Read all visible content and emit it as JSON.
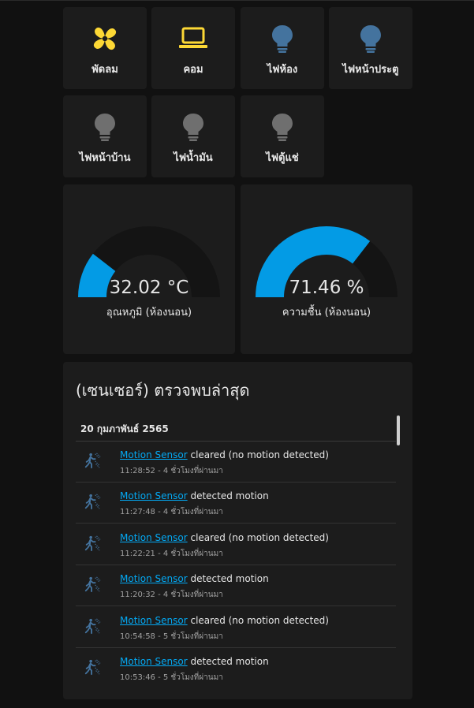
{
  "buttons": [
    {
      "label": "พัดลม",
      "icon": "fan-icon",
      "color": "#fdd835"
    },
    {
      "label": "คอม",
      "icon": "laptop-icon",
      "color": "#fdd835"
    },
    {
      "label": "ไฟห้อง",
      "icon": "lightbulb-icon",
      "color": "#44739e"
    },
    {
      "label": "ไฟหน้าประตู",
      "icon": "lightbulb-icon",
      "color": "#44739e"
    },
    {
      "label": "ไฟหน้าบ้าน",
      "icon": "lightbulb-icon",
      "color": "#6f6f6f"
    },
    {
      "label": "ไฟน้ำมัน",
      "icon": "lightbulb-icon",
      "color": "#6f6f6f"
    },
    {
      "label": "ไฟตู้แช่",
      "icon": "lightbulb-icon",
      "color": "#6f6f6f"
    }
  ],
  "gauges": [
    {
      "value": "32.02 °C",
      "name": "อุณหภูมิ (ห้องนอน)",
      "fraction": 0.21,
      "color": "#039be5",
      "track": "#141414"
    },
    {
      "value": "71.46 %",
      "name": "ความชื้น (ห้องนอน)",
      "fraction": 0.71,
      "color": "#039be5",
      "track": "#141414"
    }
  ],
  "logbook": {
    "title": "(เซนเซอร์) ตรวจพบล่าสุด",
    "date": "20 กุมภาพันธ์ 2565",
    "entries": [
      {
        "entity": "Motion Sensor",
        "message": "cleared (no motion detected)",
        "time": "11:28:52 - 4 ชั่วโมงที่ผ่านมา"
      },
      {
        "entity": "Motion Sensor",
        "message": "detected motion",
        "time": "11:27:48 - 4 ชั่วโมงที่ผ่านมา"
      },
      {
        "entity": "Motion Sensor",
        "message": "cleared (no motion detected)",
        "time": "11:22:21 - 4 ชั่วโมงที่ผ่านมา"
      },
      {
        "entity": "Motion Sensor",
        "message": "detected motion",
        "time": "11:20:32 - 4 ชั่วโมงที่ผ่านมา"
      },
      {
        "entity": "Motion Sensor",
        "message": "cleared (no motion detected)",
        "time": "10:54:58 - 5 ชั่วโมงที่ผ่านมา"
      },
      {
        "entity": "Motion Sensor",
        "message": "detected motion",
        "time": "10:53:46 - 5 ชั่วโมงที่ผ่านมา"
      }
    ]
  }
}
